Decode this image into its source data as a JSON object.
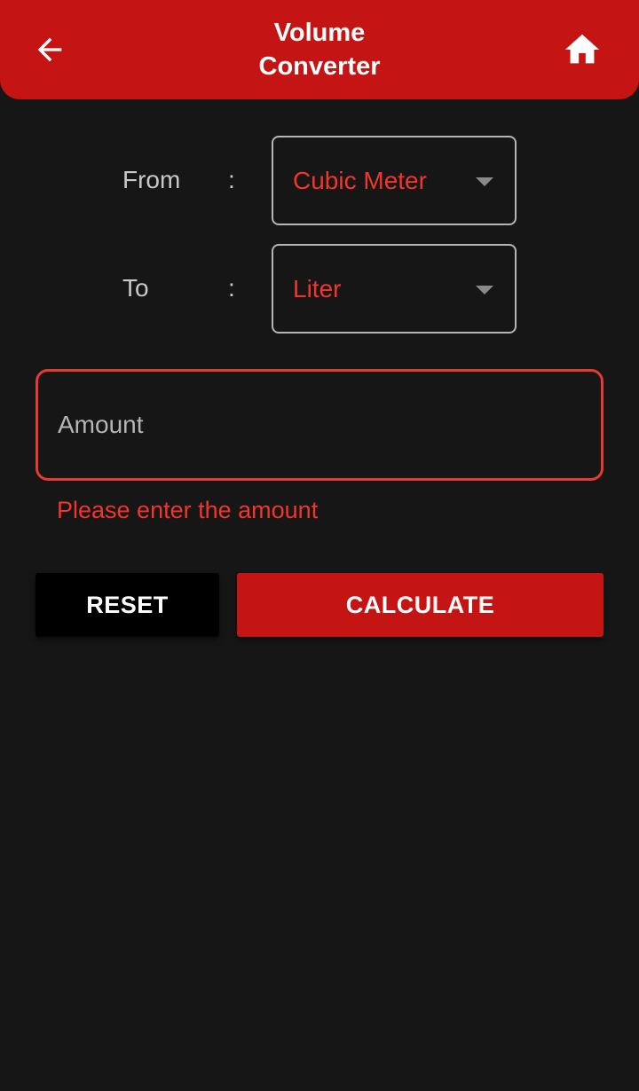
{
  "app_bar": {
    "title_line1": "Volume",
    "title_line2": "Converter",
    "back_icon": "arrow-left-icon",
    "home_icon": "home-icon",
    "color": "#c51414"
  },
  "form": {
    "from_label": "From",
    "to_label": "To",
    "separator": ":",
    "from_value": "Cubic Meter",
    "to_value": "Liter",
    "amount_placeholder": "Amount",
    "amount_value": "",
    "error_message": "Please enter the amount"
  },
  "actions": {
    "reset_label": "RESET",
    "calculate_label": "CALCULATE"
  },
  "colors": {
    "accent": "#c51414",
    "error": "#f0362a",
    "background": "#161616"
  }
}
